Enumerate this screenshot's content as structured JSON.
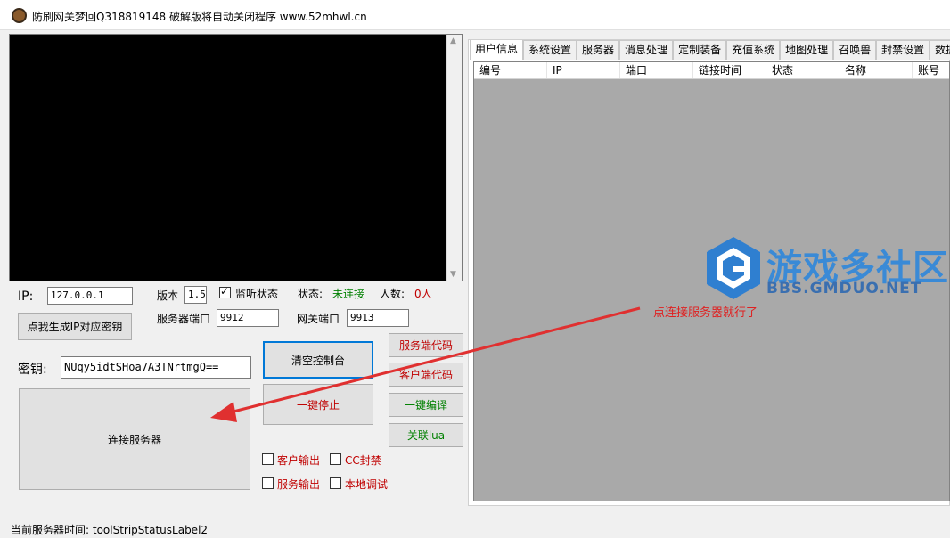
{
  "window": {
    "title": "防刷网关梦回Q318819148  破解版将自动关闭程序 www.52mhwl.cn",
    "icon": "app-icon"
  },
  "left": {
    "ip_label": "IP:",
    "ip_value": "127.0.0.1",
    "version_label": "版本",
    "version_value": "1.5",
    "listen_label": "监听状态",
    "listen_checked": true,
    "status_label": "状态:",
    "status_value": "未连接",
    "count_label": "人数:",
    "count_value": "0人",
    "gen_key_button": "点我生成IP对应密钥",
    "server_port_label": "服务器端口",
    "server_port_value": "9912",
    "gateway_port_label": "网关端口",
    "gateway_port_value": "9913",
    "key_label": "密钥:",
    "key_value": "NUqy5idtSHoa7A3TNrtmgQ==",
    "clear_console_button": "清空控制台",
    "stop_button": "一键停止",
    "connect_button": "连接服务器",
    "server_code_button": "服务端代码",
    "client_code_button": "客户端代码",
    "compile_button": "一键编译",
    "lua_button": "关联lua",
    "checkboxes": [
      {
        "label": "客户输出",
        "checked": false
      },
      {
        "label": "CC封禁",
        "checked": false
      },
      {
        "label": "服务输出",
        "checked": false
      },
      {
        "label": "本地调试",
        "checked": false
      }
    ]
  },
  "tabs": [
    "用户信息",
    "系统设置",
    "服务器",
    "消息处理",
    "定制装备",
    "充值系统",
    "地图处理",
    "召唤兽",
    "封禁设置",
    "数据"
  ],
  "table": {
    "columns": [
      "编号",
      "IP",
      "端口",
      "链接时间",
      "状态",
      "名称",
      "账号"
    ],
    "rows": []
  },
  "watermark": {
    "title": "游戏多社区",
    "subtitle": "BBS.GMDUO.NET"
  },
  "annotation": "点连接服务器就行了",
  "statusbar": {
    "text": "当前服务器时间:  toolStripStatusLabel2"
  },
  "colors": {
    "status_disconnected": "#008000",
    "count": "#c00000",
    "annotation": "#e02020",
    "listview_bg": "#a9a9a9",
    "focus": "#0078d7"
  }
}
